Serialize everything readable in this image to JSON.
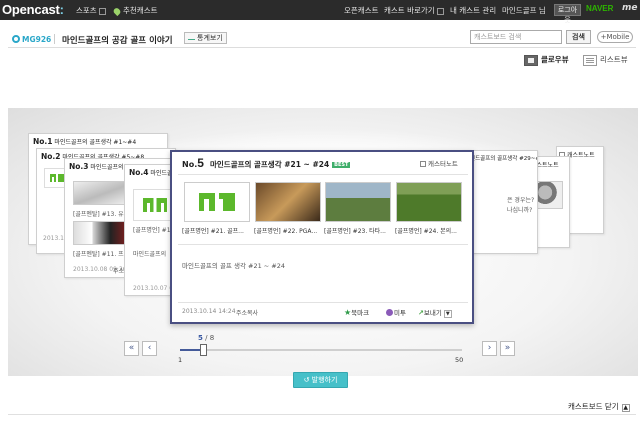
{
  "topbar": {
    "logo": "Opencast",
    "logo_dot": ":",
    "nav": [
      {
        "label": "스포츠"
      },
      {
        "label": "추천캐스트"
      }
    ],
    "links": [
      "오픈캐스트",
      "캐스트 바로가기",
      "내 캐스트 관리",
      "마인드골프 님"
    ],
    "logout": "로그아웃",
    "naver": "NAVER",
    "more": "me"
  },
  "header": {
    "channel_id": "MG926",
    "channel_title": "마인드골프의 공감 골프 이야기",
    "stats_button": "통계보기",
    "search_placeholder": "캐스트보드 검색",
    "search_button": "검색",
    "mobile_button": "+Mobile"
  },
  "views": {
    "cover": "클로우뷰",
    "list": "리스트뷰"
  },
  "cards": {
    "c1_no": "No.1",
    "c1_title": "마인드골프의 골프생각 #1~#4",
    "c2_no": "No.2",
    "c2_title": "마인드골프의 골프생각 #5~#8",
    "c2_date": "2013.10.14 08:0",
    "c3_no": "No.3",
    "c3_title": "마인드골프의 골",
    "c3_cap1": "[골프멘탈] #13. 유호",
    "c3_cap2": "[골프멘탈] #11. 프",
    "c3_date": "2013.10.08 09:36",
    "c3_addr": "주소",
    "c4_no": "No.4",
    "c4_title": "마인드골프의",
    "c4_cap": "[골프명언] #1",
    "c4_sum": "마인드골프의",
    "c4_date": "2013.10.07 09:",
    "r1_title": "마인드골프의 골프생각 #29~#32",
    "r1_text1": "은 경우는?",
    "r1_text2": "나십니까?",
    "r2_title": "캐스트노트",
    "r3_title": "캐스트노트"
  },
  "main_card": {
    "no_prefix": "No.",
    "no": "5",
    "title": "마인드골프의 골프생각 #21 ~ #24",
    "badge": "BEST",
    "castnote": "캐스터노트",
    "captions": [
      "[골프명언] #21. 골프...",
      "[골프명언] #22. PGA...",
      "[골프명언] #23. 타타...",
      "[골프명언] #24. 본의..."
    ],
    "summary": "마인드골프의 골프 생각 #21 ~ #24",
    "date": "2013.10.14 14:24",
    "address": "주소복사",
    "bookmark": "북마크",
    "metoo": "미투",
    "send": "보내기"
  },
  "pager": {
    "current": "5",
    "separator": " / ",
    "total": "8",
    "min": "1",
    "max": "50",
    "position": 0.08
  },
  "actions": {
    "publish": "발행하기",
    "close": "캐스트보드 닫기"
  },
  "colors": {
    "topbar": "#2b2b2b",
    "accent": "#4a4f82",
    "brand_green": "#5cb82c",
    "publish": "#46c0c9"
  }
}
